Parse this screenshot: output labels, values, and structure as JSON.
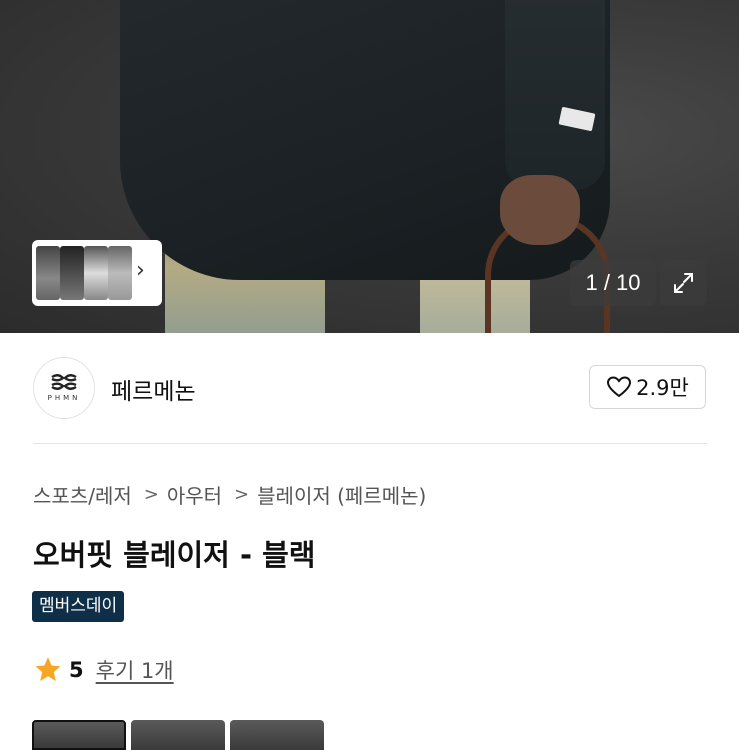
{
  "gallery": {
    "counter": "1 / 10",
    "thumbnail_count_shown": 4
  },
  "seller": {
    "logo_text": "PHMN",
    "name": "페르메논",
    "like_count": "2.9만"
  },
  "breadcrumb": [
    "스포츠/레저",
    "아우터",
    "블레이저 (페르메논)"
  ],
  "product": {
    "title": "오버핏 블레이저 - 블랙",
    "badge": "멤버스데이"
  },
  "rating": {
    "score": "5",
    "review_link": "후기 1개"
  },
  "colors": {
    "badge_bg": "#0e2f47",
    "star": "#f5a623"
  }
}
